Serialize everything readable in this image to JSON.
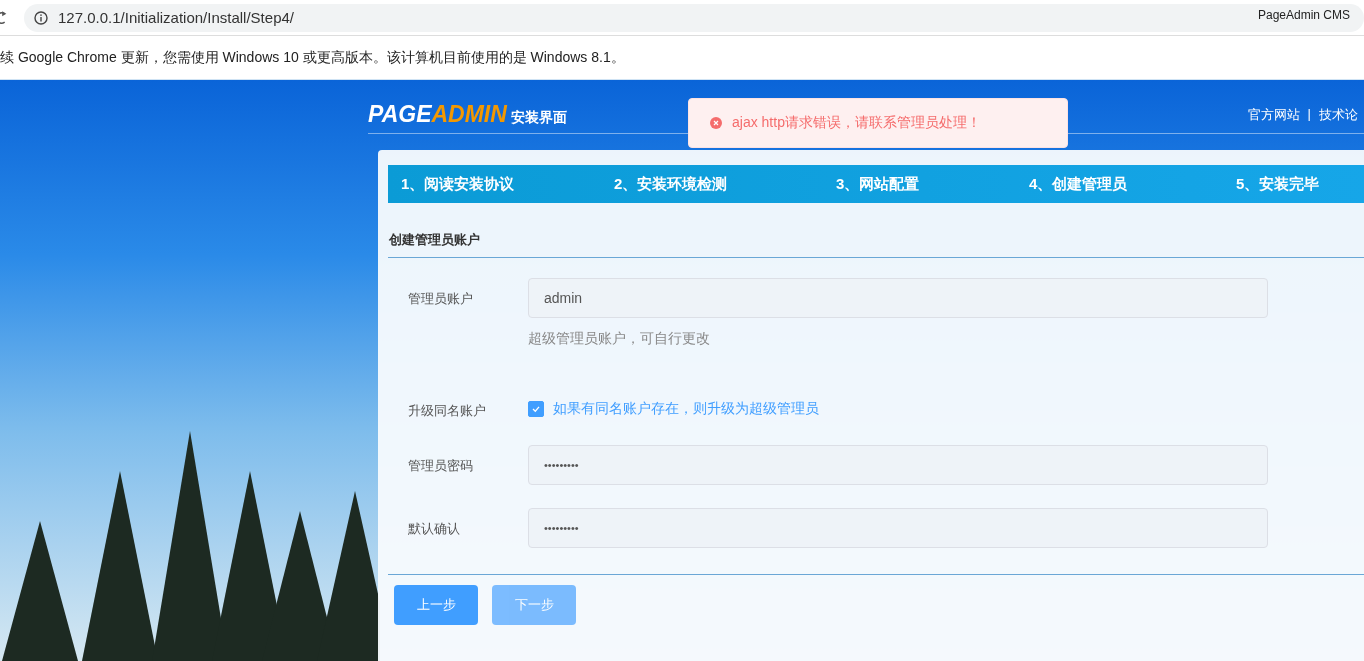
{
  "browser": {
    "url": "127.0.0.1/Initialization/Install/Step4/",
    "extension_label": "PageAdmin CMS"
  },
  "notice": {
    "text": "续 Google Chrome 更新，您需使用 Windows 10 或更高版本。该计算机目前使用的是 Windows 8.1。"
  },
  "header": {
    "logo": {
      "part_1": "PAGE",
      "part_2": "ADMIN",
      "subtitle": "安装界面"
    },
    "links": [
      "官方网站",
      "技术论"
    ],
    "separator": "|"
  },
  "toast": {
    "kind": "error",
    "message": "ajax http请求错误，请联系管理员处理！"
  },
  "steps": [
    {
      "label": "1、阅读安装协议"
    },
    {
      "label": "2、安装环境检测"
    },
    {
      "label": "3、网站配置"
    },
    {
      "label": "4、创建管理员"
    },
    {
      "label": "5、安装完毕"
    }
  ],
  "section_title": "创建管理员账户",
  "fields": [
    {
      "kind": "text",
      "label": "管理员账户",
      "value": "admin",
      "hint": "超级管理员账户，可自行更改"
    },
    {
      "kind": "checkbox",
      "label": "升级同名账户",
      "text": "如果有同名账户存在，则升级为超级管理员",
      "checked": true
    },
    {
      "kind": "password",
      "label": "管理员密码",
      "value": "•••••••••"
    },
    {
      "kind": "password",
      "label": "默认确认",
      "value": "•••••••••"
    }
  ],
  "buttons": [
    {
      "label": "上一步",
      "disabled": false
    },
    {
      "label": "下一步",
      "disabled": true
    }
  ]
}
